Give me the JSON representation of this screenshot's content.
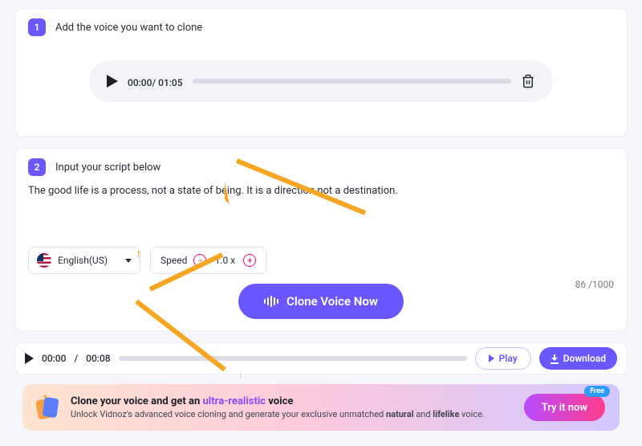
{
  "step1": {
    "num": "1",
    "title": "Add the voice you want to clone",
    "audio": {
      "current": "00:00",
      "total": "01:05"
    }
  },
  "step2": {
    "num": "2",
    "title": "Input your script below",
    "script": "The good life is a process, not a state of being. It is a direction not a destination.",
    "language": "English(US)",
    "speed_label": "Speed",
    "speed_value": "1.0 x",
    "char_count": "86 /1000",
    "clone_button": "Clone Voice Now"
  },
  "result": {
    "current": "00:00",
    "total": "00:08",
    "play_label": "Play",
    "download_label": "Download"
  },
  "promo": {
    "title_pre": "Clone your voice and get an ",
    "title_hl": "ultra-realistic",
    "title_post": " voice",
    "sub_pre": "Unlock Vidnoz's advanced voice cloning and generate your exclusive unmatched ",
    "sub_b1": "natural",
    "sub_mid": " and ",
    "sub_b2": "lifelike",
    "sub_post": " voice.",
    "try": "Try it now",
    "free": "Free"
  }
}
